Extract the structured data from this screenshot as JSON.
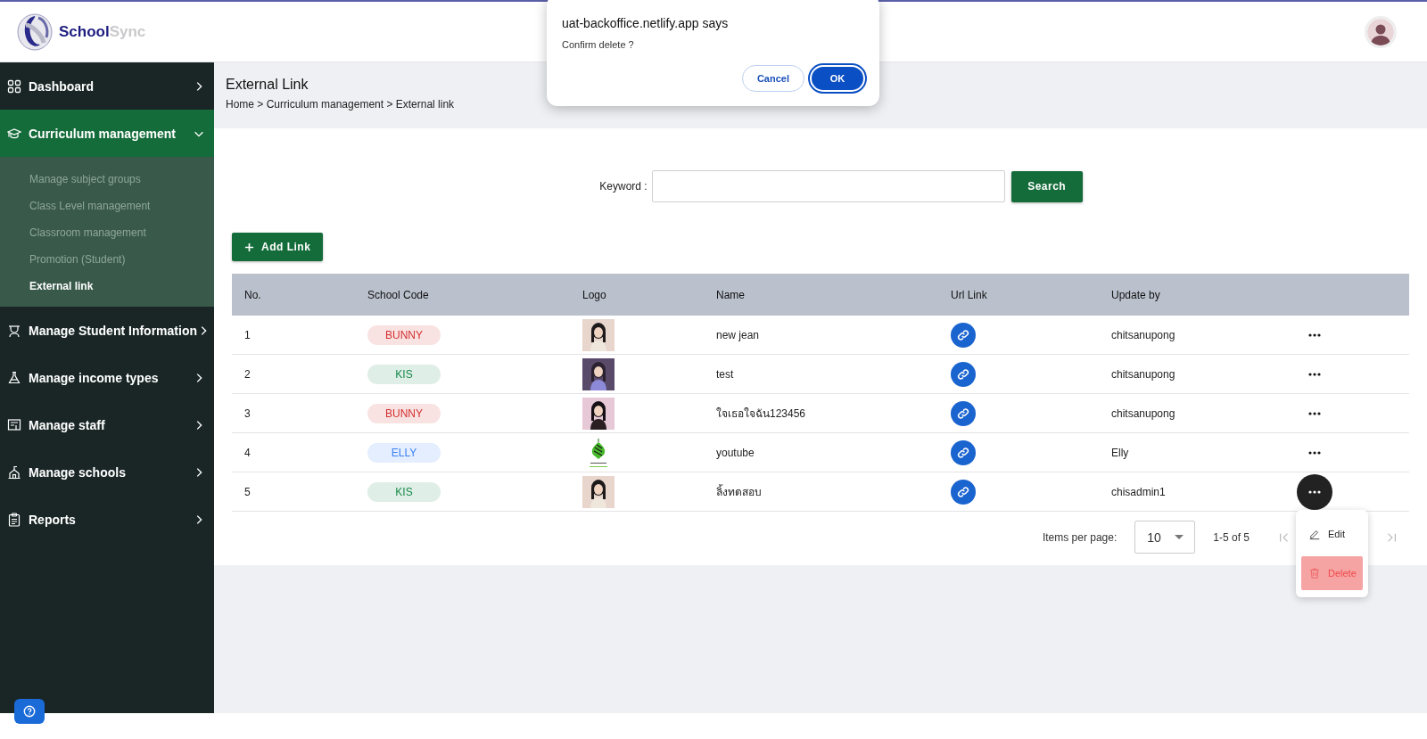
{
  "header": {
    "brand": {
      "part_1": "School",
      "part_2": "Sync"
    }
  },
  "dialog": {
    "title": "uat-backoffice.netlify.app says",
    "message": "Confirm delete ?",
    "buttons": [
      {
        "label": "Cancel",
        "kind": "secondary"
      },
      {
        "label": "OK",
        "kind": "primary"
      }
    ]
  },
  "sidebar": {
    "items": [
      {
        "label": "Dashboard",
        "expanded": false,
        "selected": false
      },
      {
        "label": "Curriculum management",
        "expanded": true,
        "selected": true,
        "children": [
          {
            "label": "Manage subject groups",
            "selected": false
          },
          {
            "label": "Class Level management",
            "selected": false
          },
          {
            "label": "Classroom management",
            "selected": false
          },
          {
            "label": "Promotion (Student)",
            "selected": false
          },
          {
            "label": "External link",
            "selected": true
          }
        ]
      },
      {
        "label": "Manage Student Information",
        "expanded": false,
        "selected": false
      },
      {
        "label": "Manage income types",
        "expanded": false,
        "selected": false
      },
      {
        "label": "Manage staff",
        "expanded": false,
        "selected": false
      },
      {
        "label": "Manage schools",
        "expanded": false,
        "selected": false
      },
      {
        "label": "Reports",
        "expanded": false,
        "selected": false
      }
    ]
  },
  "page": {
    "title": "External Link",
    "breadcrumb": "Home > Curriculum management > External link"
  },
  "search": {
    "label": "Keyword :",
    "button": "Search"
  },
  "add_button": "Add Link",
  "table": {
    "columns": [
      "No.",
      "School Code",
      "Logo",
      "Name",
      "Url Link",
      "Update by"
    ],
    "rows": [
      {
        "no": "1",
        "school_code": "BUNNY",
        "color": "#d32f2f",
        "name": "new jean",
        "update_by": "chitsanupong",
        "menu_open": false
      },
      {
        "no": "2",
        "school_code": "KIS",
        "color": "#17894a",
        "name": "test",
        "update_by": "chitsanupong",
        "menu_open": false
      },
      {
        "no": "3",
        "school_code": "BUNNY",
        "color": "#d32f2f",
        "name": "ใจเธอใจฉัน123456",
        "update_by": "chitsanupong",
        "menu_open": false
      },
      {
        "no": "4",
        "school_code": "ELLY",
        "color": "#3b82f6",
        "name": "youtube",
        "update_by": "Elly",
        "menu_open": false
      },
      {
        "no": "5",
        "school_code": "KIS",
        "color": "#17894a",
        "name": "ลิ้งทดสอบ",
        "update_by": "chisadmin1",
        "menu_open": true
      }
    ]
  },
  "row_menu": [
    {
      "label": "Edit",
      "kind": "edit",
      "selected": false
    },
    {
      "label": "Delete",
      "kind": "delete",
      "selected": true
    }
  ],
  "pagination": {
    "label": "Items per page:",
    "page_size": "10",
    "range": "1-5 of 5"
  }
}
